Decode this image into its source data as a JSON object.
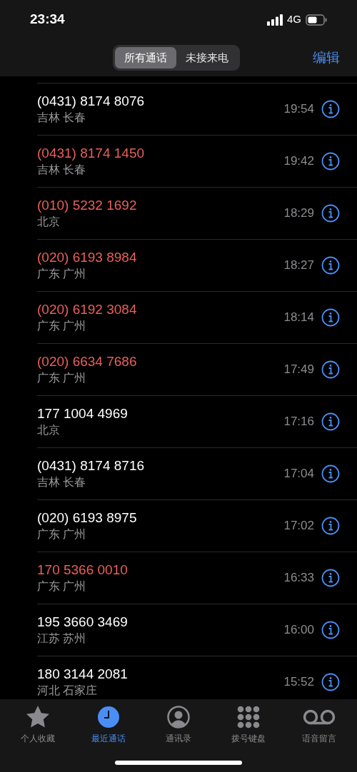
{
  "status_bar": {
    "time": "23:34",
    "network": "4G"
  },
  "nav": {
    "segments": [
      {
        "label": "所有通话",
        "selected": true
      },
      {
        "label": "未接来电",
        "selected": false
      }
    ],
    "edit": "编辑"
  },
  "calls": [
    {
      "number": "(0431) 8174 8076",
      "location": "吉林 长春",
      "time": "19:54",
      "missed": false
    },
    {
      "number": "(0431) 8174 1450",
      "location": "吉林 长春",
      "time": "19:42",
      "missed": true
    },
    {
      "number": "(010) 5232 1692",
      "location": "北京",
      "time": "18:29",
      "missed": true
    },
    {
      "number": "(020) 6193 8984",
      "location": "广东 广州",
      "time": "18:27",
      "missed": true
    },
    {
      "number": "(020) 6192 3084",
      "location": "广东 广州",
      "time": "18:14",
      "missed": true
    },
    {
      "number": "(020) 6634 7686",
      "location": "广东 广州",
      "time": "17:49",
      "missed": true
    },
    {
      "number": "177 1004 4969",
      "location": "北京",
      "time": "17:16",
      "missed": false
    },
    {
      "number": "(0431) 8174 8716",
      "location": "吉林 长春",
      "time": "17:04",
      "missed": false
    },
    {
      "number": "(020) 6193 8975",
      "location": "广东 广州",
      "time": "17:02",
      "missed": false
    },
    {
      "number": "170 5366 0010",
      "location": "广东 广州",
      "time": "16:33",
      "missed": true
    },
    {
      "number": "195 3660 3469",
      "location": "江苏 苏州",
      "time": "16:00",
      "missed": false
    },
    {
      "number": "180 3144 2081",
      "location": "河北 石家庄",
      "time": "15:52",
      "missed": false
    }
  ],
  "tab_bar": [
    {
      "kind": "star",
      "label": "个人收藏",
      "selected": false
    },
    {
      "kind": "clock",
      "label": "最近通话",
      "selected": true
    },
    {
      "kind": "person",
      "label": "通讯录",
      "selected": false
    },
    {
      "kind": "keypad",
      "label": "拨号键盘",
      "selected": false
    },
    {
      "kind": "voicemail",
      "label": "语音留言",
      "selected": false
    }
  ]
}
